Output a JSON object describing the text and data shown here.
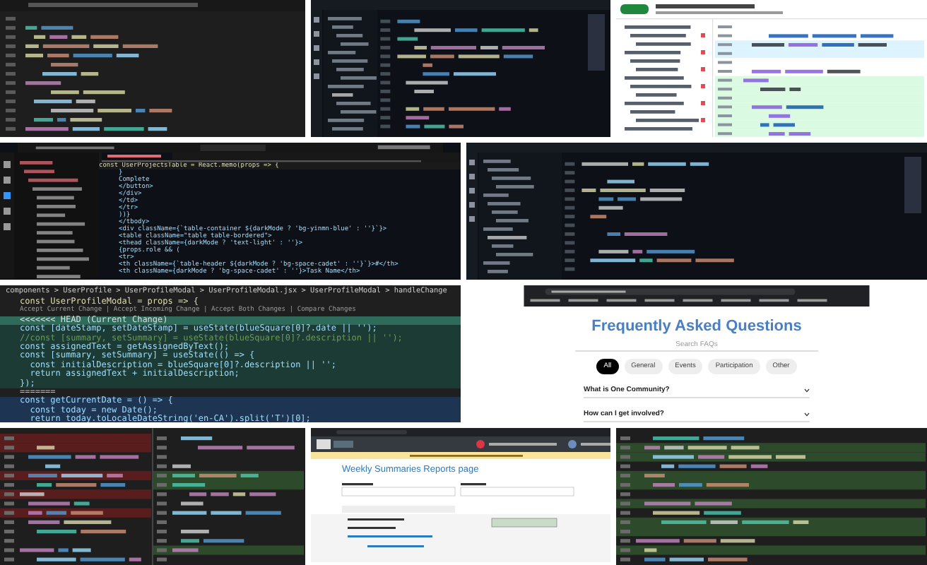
{
  "panels": [
    {
      "kind": "dark-editor"
    },
    {
      "kind": "dark-editor-sidebar"
    },
    {
      "kind": "light-diff"
    },
    {
      "kind": "vscode-code",
      "sticky_line": "const UserProjectsTable = React.memo(props => {",
      "lines": [
        "}",
        "Complete",
        "</button>",
        "</div>",
        "</td>",
        "</tr>",
        "))}",
        "</tbody>",
        "<div className={`table-container ${darkMode ? 'bg-yinmn-blue' : ''}`}>",
        "<table className=\"table table-bordered\">",
        "<thead className={darkMode ? 'text-light' : ''}>",
        "{props.role && (",
        "<tr>",
        "<th className={`table-header ${darkMode ? 'bg-space-cadet' : ''}`}>#</th>",
        "<th className={darkMode ? 'bg-space-cadet' : ''}>Task Name</th>"
      ]
    },
    {
      "kind": "dark-editor-sidebar"
    },
    {
      "kind": "merge-conflict",
      "breadcrumb": "components > UserProfile > UserProfileModal > UserProfileModal.jsx > UserProfileModal > handleChange",
      "lines": [
        {
          "kind": "code",
          "text": "const UserProfileModal = props => {"
        },
        {
          "kind": "codelens",
          "text": "Accept Current Change | Accept Incoming Change | Accept Both Changes | Compare Changes"
        },
        {
          "kind": "current-header",
          "text": "<<<<<<< HEAD (Current Change)"
        },
        {
          "kind": "current",
          "text": "const [dateStamp, setDateStamp] = useState(blueSquare[0]?.date || '');"
        },
        {
          "kind": "current-comment",
          "text": "//const [summary, setSummary] = useState(blueSquare[0]?.description || '');"
        },
        {
          "kind": "current",
          "text": "const assignedText = getAssignedByText();"
        },
        {
          "kind": "current",
          "text": "const [summary, setSummary] = useState(() => {"
        },
        {
          "kind": "current",
          "text": "  const initialDescription = blueSquare[0]?.description || '';"
        },
        {
          "kind": "current",
          "text": "  return assignedText + initialDescription;"
        },
        {
          "kind": "current",
          "text": "});"
        },
        {
          "kind": "separator",
          "text": "======="
        },
        {
          "kind": "incoming",
          "text": "const getCurrentDate = () => {"
        },
        {
          "kind": "incoming",
          "text": "  const today = new Date();"
        },
        {
          "kind": "incoming",
          "text": "  return today.toLocaleDateString('en-CA').split('T')[0];"
        }
      ]
    },
    {
      "kind": "faq-page",
      "title": "Frequently Asked Questions",
      "search": {
        "placeholder": "Search FAQs"
      },
      "filters": [
        {
          "label": "All",
          "selected": true
        },
        {
          "label": "General",
          "selected": false
        },
        {
          "label": "Events",
          "selected": false
        },
        {
          "label": "Participation",
          "selected": false
        },
        {
          "label": "Other",
          "selected": false
        }
      ],
      "questions": [
        "What is One Community?",
        "How can I get involved?"
      ]
    },
    {
      "kind": "dark-diff"
    },
    {
      "kind": "web-app",
      "title": "Weekly Summaries Reports page"
    },
    {
      "kind": "dark-diff-green"
    }
  ]
}
